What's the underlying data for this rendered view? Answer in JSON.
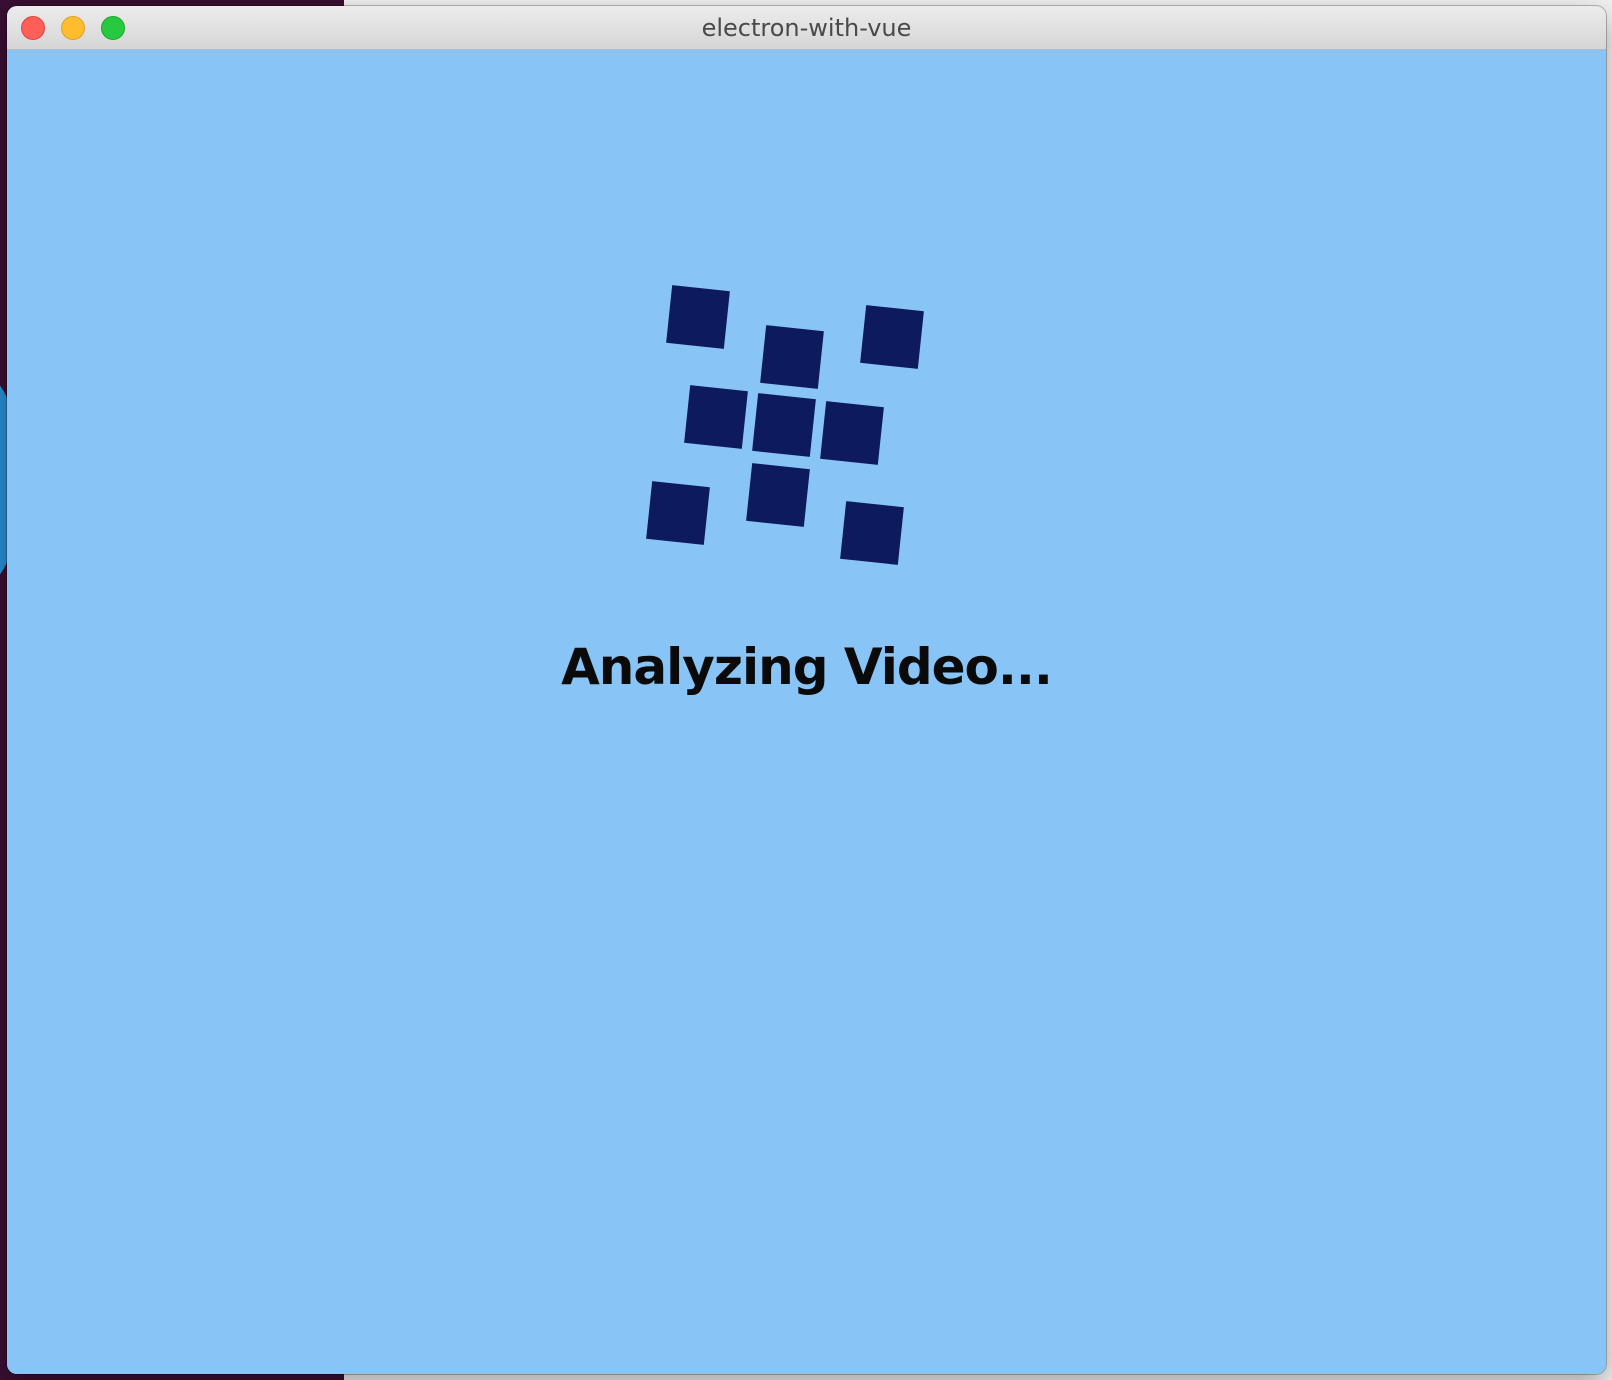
{
  "window": {
    "title": "electron-with-vue"
  },
  "main": {
    "status_text": "Analyzing Video...",
    "loader_icon": "grid-cube-loader-icon"
  },
  "colors": {
    "background": "#89c4f6",
    "loader_cube": "#0e1a5e",
    "text": "#0a0a0a"
  }
}
